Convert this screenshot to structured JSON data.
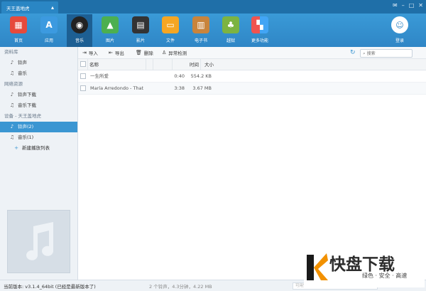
{
  "titlebar": {
    "tab_label": "天王盖地虎",
    "window_controls": [
      "message-icon",
      "minimize-icon",
      "maximize-icon",
      "close-icon"
    ]
  },
  "toolbar": {
    "items": [
      {
        "label": "首页",
        "icon": "home-icon",
        "color": "#e64a3c"
      },
      {
        "label": "应用",
        "icon": "app-store-icon",
        "color": "#3c9ae0"
      },
      {
        "label": "音乐",
        "icon": "music-disc-icon",
        "color": "#222222"
      },
      {
        "label": "图片",
        "icon": "picture-icon",
        "color": "#4caf50"
      },
      {
        "label": "影片",
        "icon": "clapper-icon",
        "color": "#333333"
      },
      {
        "label": "文件",
        "icon": "folder-icon",
        "color": "#f5a623"
      },
      {
        "label": "电子书",
        "icon": "book-icon",
        "color": "#c8843c"
      },
      {
        "label": "越狱",
        "icon": "pineapple-icon",
        "color": "#7cb342"
      },
      {
        "label": "更多功能",
        "icon": "more-apps-icon",
        "color": "#ef5350"
      }
    ],
    "active": "音乐",
    "login_label": "登录"
  },
  "sidebar": {
    "sections": [
      {
        "title": "资料库",
        "items": [
          {
            "label": "铃声",
            "icon": "bell-icon"
          },
          {
            "label": "音乐",
            "icon": "note-icon"
          }
        ]
      },
      {
        "title": "网络资源",
        "items": [
          {
            "label": "铃声下载",
            "icon": "bell-icon"
          },
          {
            "label": "音乐下载",
            "icon": "note-icon"
          }
        ]
      },
      {
        "title": "设备 - 天王盖地虎",
        "items": [
          {
            "label": "铃声(2)",
            "icon": "bell-icon"
          },
          {
            "label": "音乐(1)",
            "icon": "note-icon"
          },
          {
            "label": "新建播放列表",
            "icon": "plus-icon"
          }
        ]
      }
    ],
    "selected": "铃声(2)"
  },
  "actions": {
    "import": "导入",
    "export": "导出",
    "delete": "删除",
    "detect": "异常检测",
    "search_placeholder": "搜索"
  },
  "table": {
    "columns": [
      "名称",
      "时间",
      "大小"
    ],
    "rows": [
      {
        "name": "一生所爱",
        "time": "0:40",
        "size": "554.2 KB"
      },
      {
        "name": "María Arredondo - That",
        "time": "3:38",
        "size": "3.67 MB"
      }
    ]
  },
  "status": {
    "version": "当前版本: v3.1.4_64bit",
    "latest_note": "(已经是最新版本了)",
    "summary": "2 个铃声，4.3分钟，4.22 MB",
    "space": "可用空间：11.4 GB"
  },
  "watermark": {
    "brand": "快盘下载",
    "tagline": "绿色 · 安全 · 高速"
  }
}
